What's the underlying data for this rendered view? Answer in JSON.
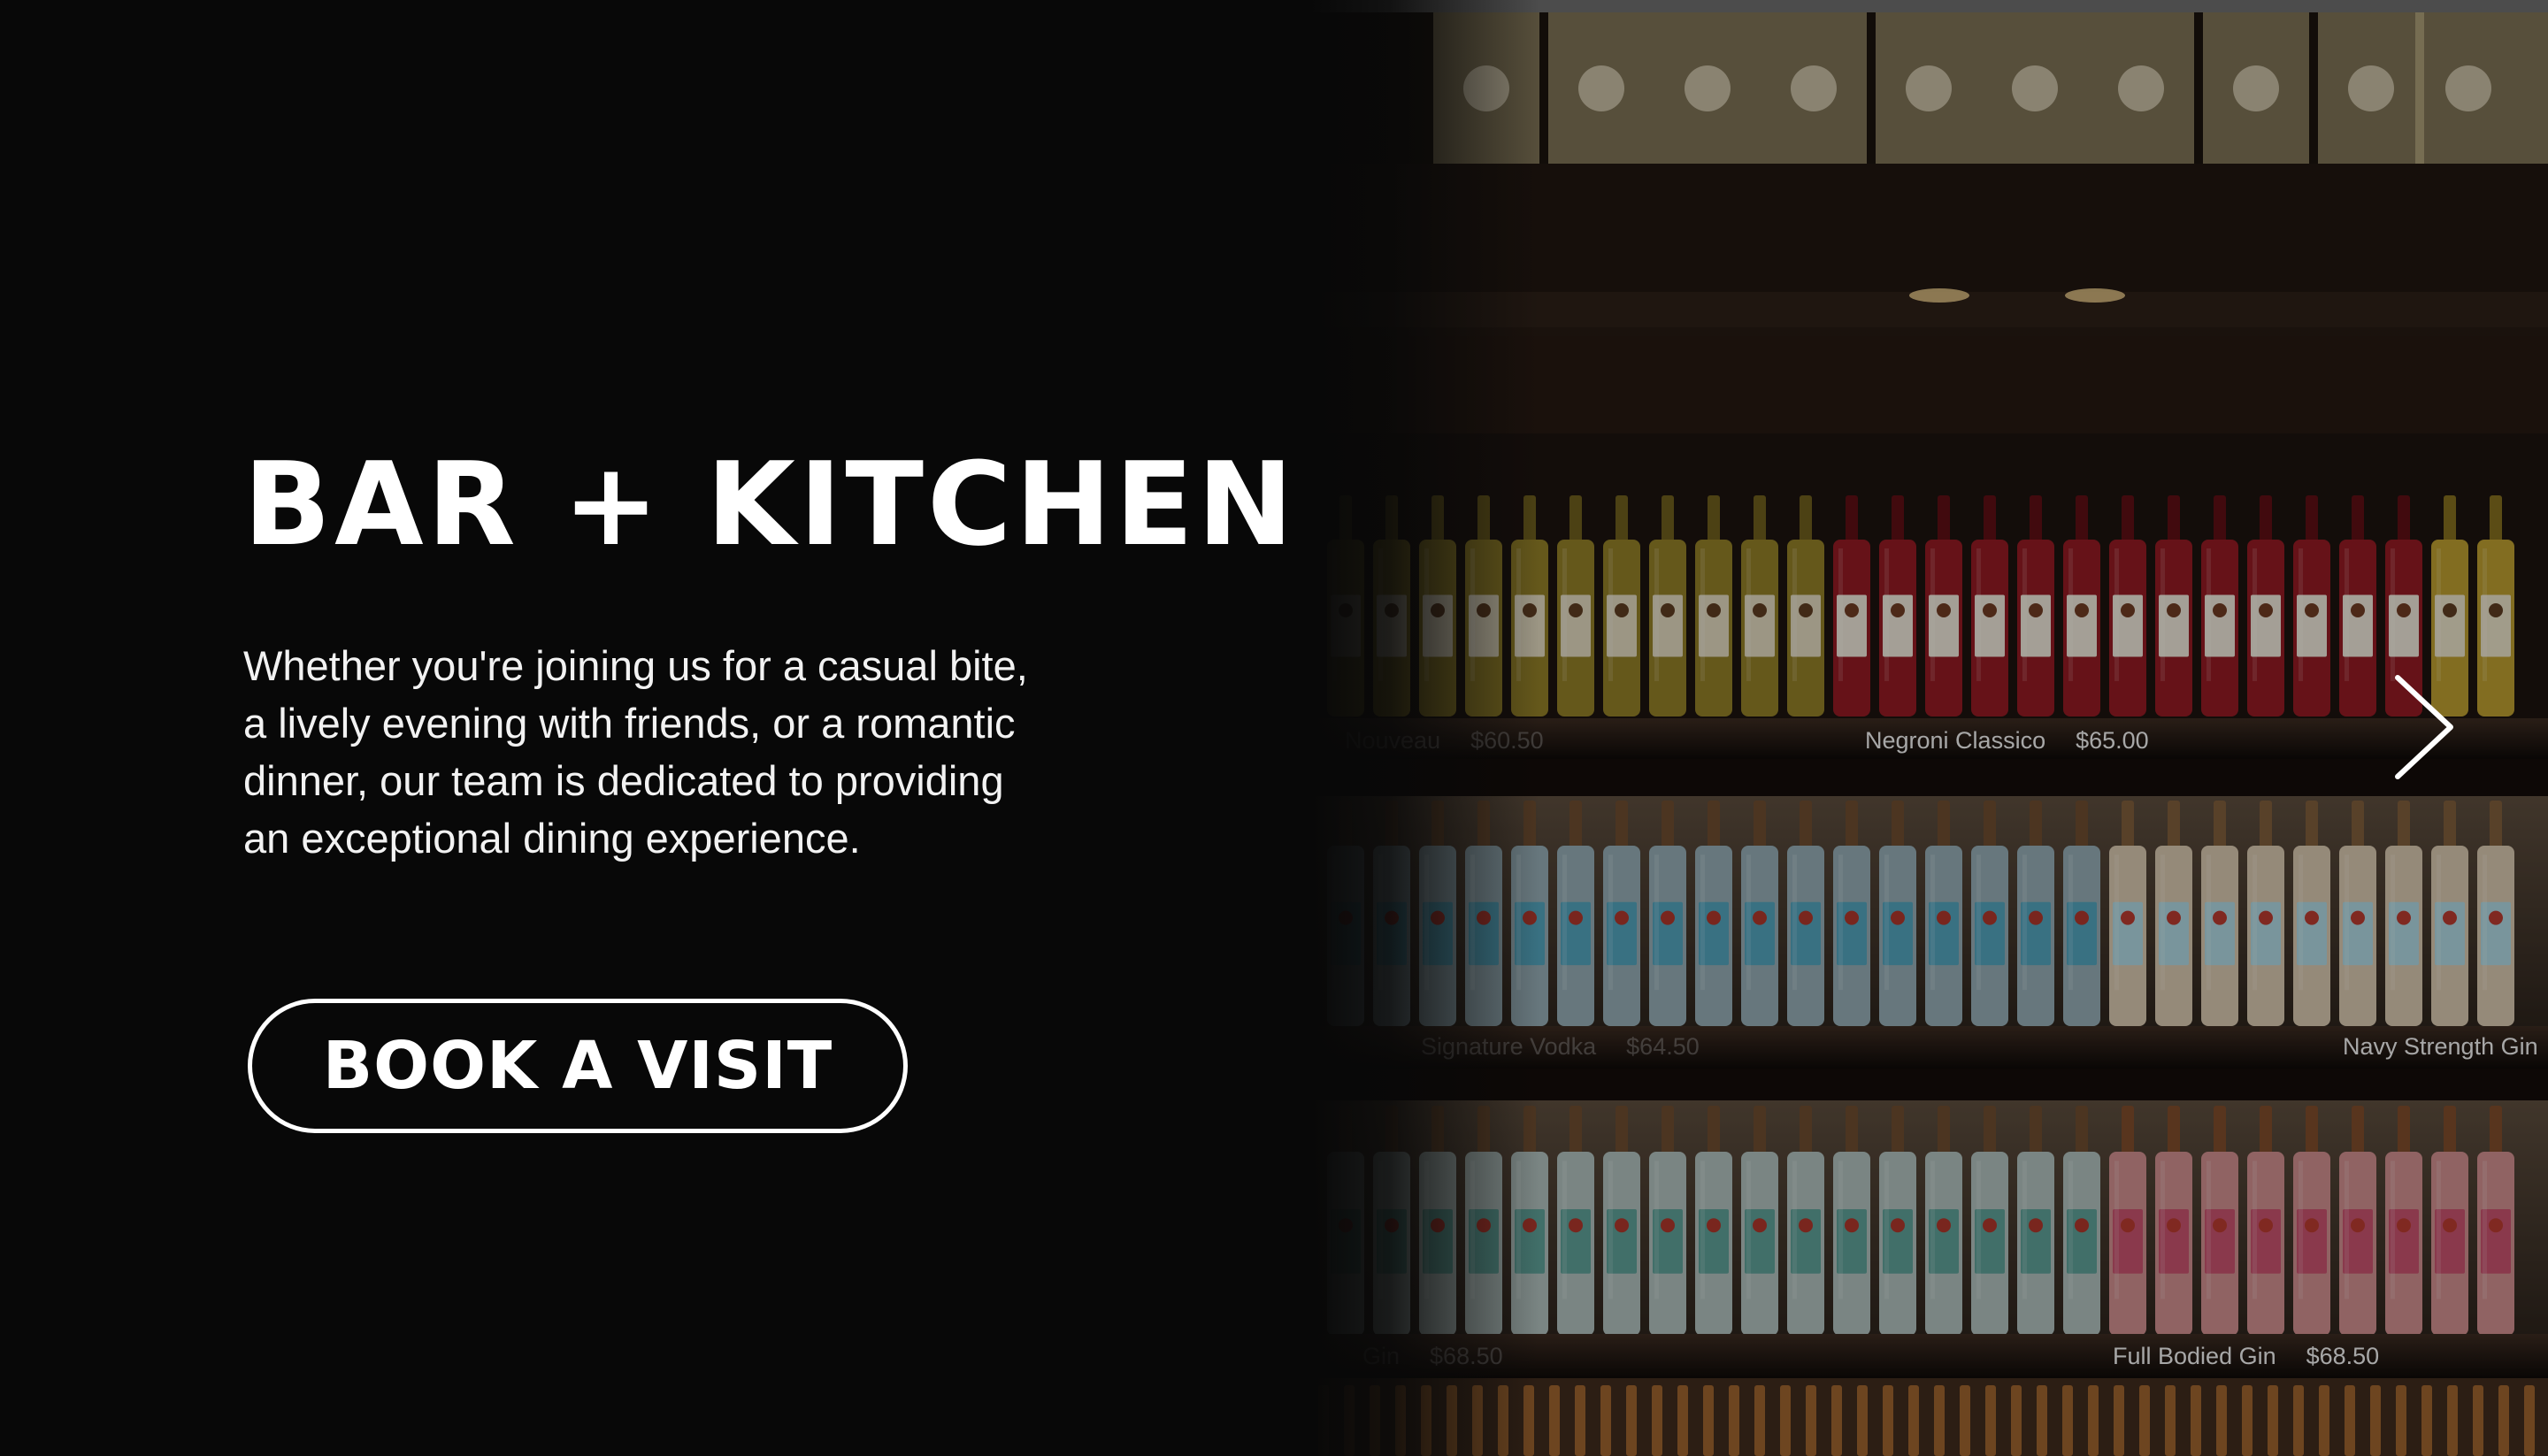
{
  "hero": {
    "title": "BAR + KITCHEN",
    "description": "Whether you're joining us for a casual bite, a lively evening with friends, or a romantic dinner, our team is dedicated to providing an exceptional dining experience.",
    "cta_label": "BOOK A VISIT"
  },
  "carousel": {
    "next_icon": "chevron-right-icon"
  },
  "shelf_labels": [
    {
      "name": "Nouveau",
      "price": "$60.50"
    },
    {
      "name": "Negroni Classico",
      "price": "$65.00"
    },
    {
      "name": "Signature Vodka",
      "price": "$64.50"
    },
    {
      "name": "Navy Strength Gin",
      "price": ""
    },
    {
      "name": "Gin",
      "price": "$68.50"
    },
    {
      "name": "Full Bodied Gin",
      "price": "$68.50"
    }
  ],
  "colors": {
    "background": "#080808",
    "text": "#ffffff",
    "accent_red": "#8e1a22",
    "accent_amber": "#c9a43a",
    "accent_teal": "#4f9db5"
  }
}
